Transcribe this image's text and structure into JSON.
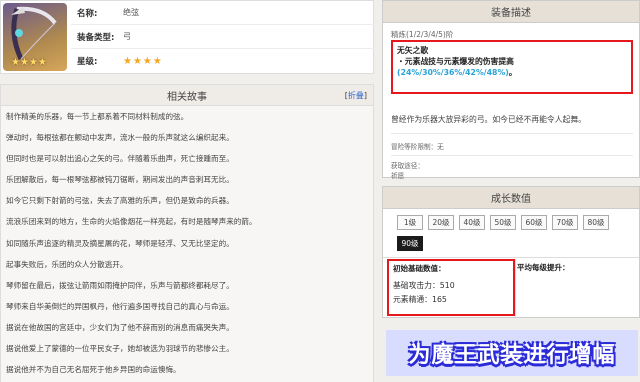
{
  "weapon": {
    "stars": "★★★★",
    "rows": [
      {
        "key": "名称:",
        "value": "绝弦"
      },
      {
        "key": "装备类型:",
        "value": "弓"
      },
      {
        "key": "星级:",
        "value": "★★★★"
      }
    ]
  },
  "story": {
    "title": "相关故事",
    "fold_label": "折叠",
    "lines": [
      "制作精美的乐器，每一节上都系着不同材料制成的弦。",
      "弹动时，每根弦都在颤动中发声，流水一般的乐声就这么编织起来。",
      "但同时也是可以射出追心之矢的弓。伴随着乐曲声，死亡接踵而至。",
      "乐团解散后，每一根琴弦都被钝刀锯断，期间发出的声音刺耳无比。",
      "如今它只剩下射箭的弓弦，失去了高雅的乐声，但仍是致命的兵器。",
      "流浪乐团来到的地方，生命的火焰像烟花一样亮起，有时是随琴声来的箭。",
      "如同随乐声追逐的精灵及摘星屠的花，琴师是轻浮、又无比坚定的。",
      "起事失败后，乐团的众人分散逃开。",
      "琴师留在最后，拨弦让箭雨如雨掩护同伴，乐声与箭都终都耗尽了。",
      "琴师来自华美倒烂的异国枫丹，他行遍多国寻找自己的真心与命运。",
      "据说在他故国的宫廷中，少女们为了他不辞而别的消息而痛哭失声。",
      "据说他爱上了蒙德的一位平民女子，她却被选为羽球节的悲惨公主。",
      "据说他并不为自己无名屈死于他乡异国的命运懊悔。"
    ]
  },
  "description": {
    "title": "装备描述",
    "refine": "精炼(1/2/3/4/5)阶",
    "passive_name": "无矢之歌",
    "passive_prefix": "・元素战技与元素爆发的伤害提高",
    "passive_values": "(24%/30%/36%/42%/48%)",
    "passive_suffix": "。",
    "flavor": "曾经作为乐器大放异彩的弓。如今已经不再能令人起舞。",
    "limit": "冒险等阶限制：无",
    "source_label": "获取途径：",
    "source_value": "祈愿"
  },
  "growth": {
    "title": "成长数值",
    "levels": [
      "1级",
      "20级",
      "40级",
      "50级",
      "60级",
      "70级",
      "80级",
      "90级"
    ],
    "active_level": "90级",
    "base_title": "初始基础数值：",
    "increase_title": "平均每级提升：",
    "stats": [
      "基础攻击力：510",
      "元素精通：165"
    ]
  },
  "banner": {
    "text": "为魔王武装进行增幅"
  },
  "colors": {
    "highlight_box": "#e5191b",
    "value_blue": "#2aa3d8",
    "banner_stroke": "#2b2bd8"
  }
}
